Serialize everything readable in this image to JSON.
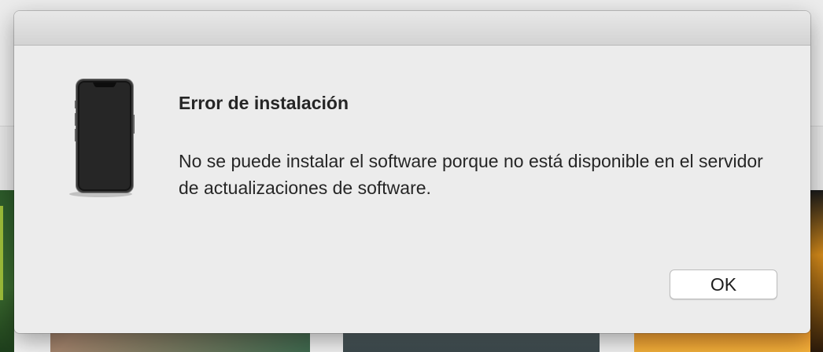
{
  "dialog": {
    "title": "Error de instalación",
    "message": "No se puede instalar el software porque no está disponible en el servidor de actualizaciones de software.",
    "ok_label": "OK",
    "icon": "iphone-icon"
  },
  "colors": {
    "dialog_background": "#ececec",
    "text": "#262626",
    "button_background": "#ffffff"
  }
}
